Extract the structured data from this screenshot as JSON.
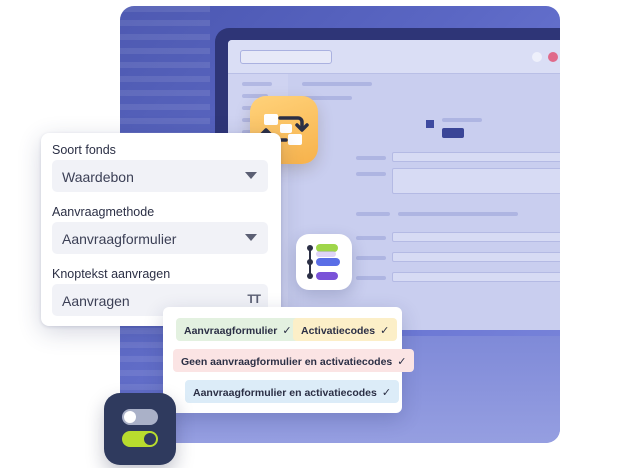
{
  "form": {
    "soort_fonds": {
      "label": "Soort fonds",
      "value": "Waardebon"
    },
    "aanvraagmethode": {
      "label": "Aanvraagmethode",
      "value": "Aanvraagformulier"
    },
    "knoptekst": {
      "label": "Knoptekst aanvragen",
      "value": "Aanvragen",
      "icon": "text-format-icon",
      "icon_glyph": "TT"
    }
  },
  "tags": [
    {
      "label": "Aanvraagformulier",
      "check": "✓"
    },
    {
      "label": "Activatiecodes",
      "check": "✓"
    },
    {
      "label": "Geen aanvraagformulier en activatiecodes",
      "check": "✓"
    },
    {
      "label": "Aanvraagformulier en activatiecodes",
      "check": "✓"
    }
  ],
  "icons": {
    "swap": "swap-flow-icon",
    "list": "list-steps-icon",
    "toggle": "toggle-switch-icon"
  },
  "colors": {
    "tag_green": "#e3f1e0",
    "tag_yellow": "#fcefc8",
    "tag_pink": "#fbe4e4",
    "tag_blue": "#dcecf8",
    "swap_tile": "#f7b24b",
    "toggle_tile": "#2f3a5e",
    "toggle_on": "#b8dc2e"
  }
}
